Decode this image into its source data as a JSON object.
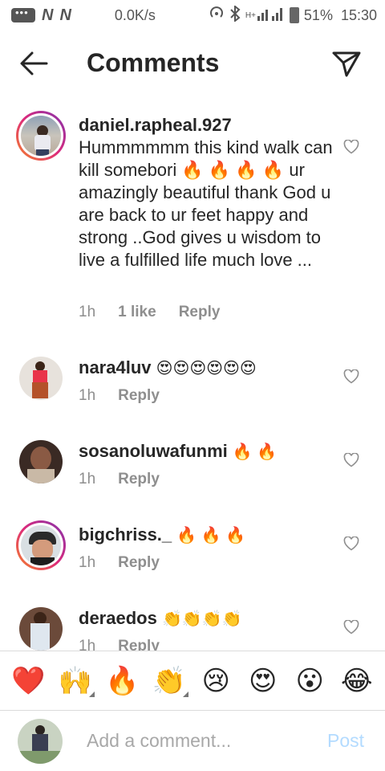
{
  "status_bar": {
    "letters": [
      "N",
      "N"
    ],
    "speed": "0.0K/s",
    "network": "H+",
    "battery": "51%",
    "time": "15:30"
  },
  "header": {
    "title": "Comments"
  },
  "comments": [
    {
      "username": "daniel.rapheal.927",
      "text": "Hummmmmm this kind walk can kill somebori 🔥 🔥 🔥 🔥 ur amazingly beautiful thank God u are back to ur feet happy and strong ..God gives u wisdom to live a fulfilled life much love ...",
      "time": "1h",
      "likes": "1 like",
      "reply": "Reply"
    },
    {
      "username": "nara4luv",
      "text": "😍😍😍😍😍😍",
      "time": "1h",
      "reply": "Reply"
    },
    {
      "username": "sosanoluwafunmi",
      "text": "🔥 🔥",
      "time": "1h",
      "reply": "Reply"
    },
    {
      "username": "bigchriss._",
      "text": "🔥 🔥 🔥",
      "time": "1h",
      "reply": "Reply"
    },
    {
      "username": "deraedos",
      "text": "👏👏👏👏",
      "time": "1h",
      "reply": "Reply"
    }
  ],
  "emoji_bar": [
    "❤️",
    "🙌",
    "🔥",
    "👏",
    "😢",
    "😍",
    "😮",
    "😂"
  ],
  "composer": {
    "placeholder": "Add a comment...",
    "post_label": "Post"
  },
  "colors": {
    "text": "#262626",
    "muted": "#8e8e8e",
    "post_disabled": "#b3dbff",
    "story_ring": "#dd2a7b"
  }
}
